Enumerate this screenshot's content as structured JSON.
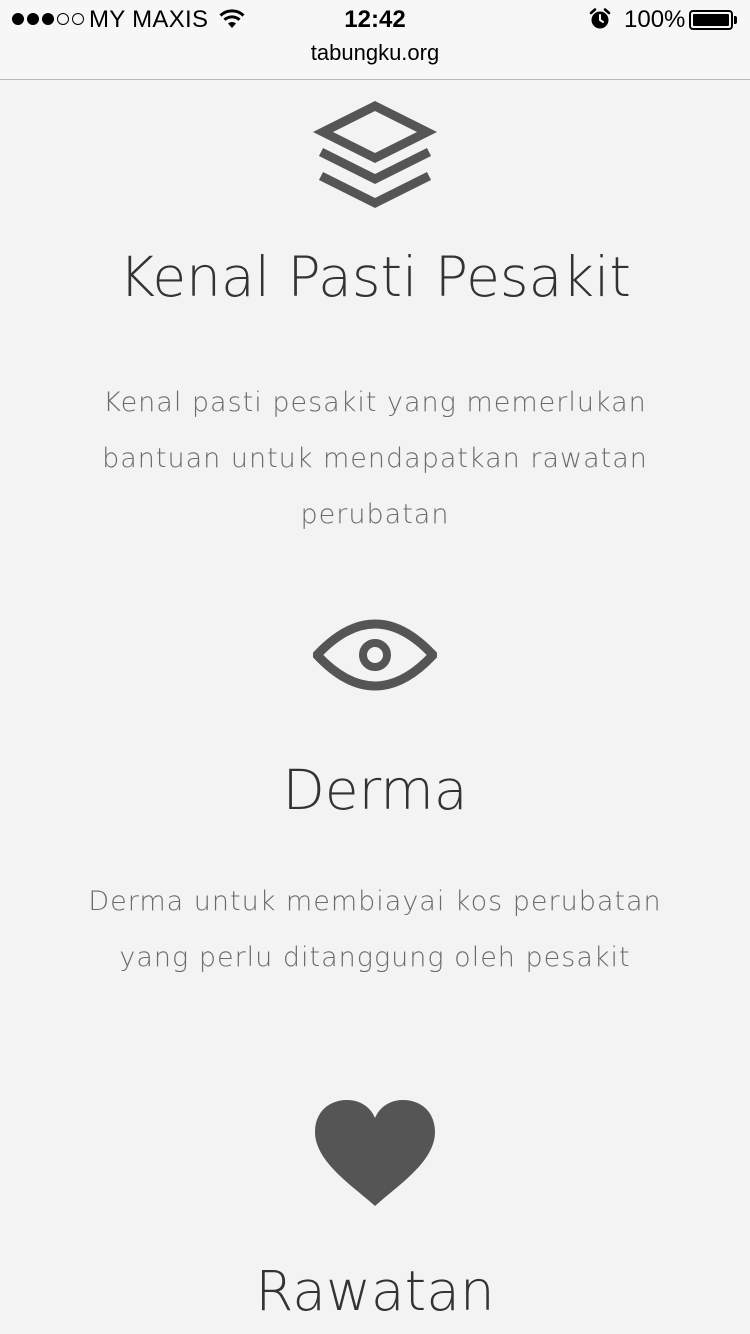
{
  "status_bar": {
    "carrier": "MY MAXIS",
    "time": "12:42",
    "battery_percent": "100%",
    "signal_bars": 3,
    "signal_total": 5
  },
  "browser": {
    "url": "tabungku.org"
  },
  "features": [
    {
      "icon": "layers-icon",
      "title": "Kenal Pasti Pesakit",
      "description": "Kenal pasti pesakit yang memerlukan bantuan untuk mendapatkan rawatan perubatan"
    },
    {
      "icon": "eye-icon",
      "title": "Derma",
      "description": "Derma untuk membiayai kos perubatan yang perlu ditanggung oleh pesakit"
    },
    {
      "icon": "heart-icon",
      "title": "Rawatan"
    }
  ],
  "colors": {
    "background": "#f3f3f3",
    "icon": "#555555",
    "title": "#333333",
    "body_text": "#6a6a6a"
  }
}
